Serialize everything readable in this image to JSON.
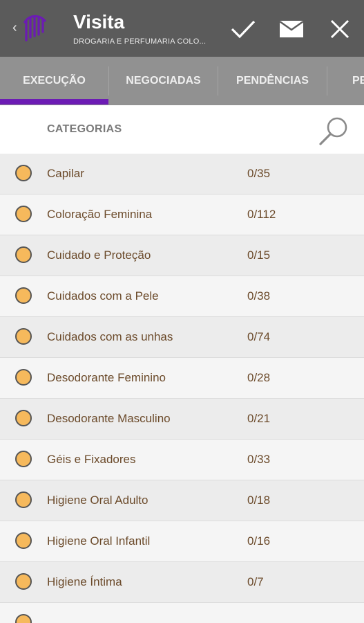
{
  "appbar": {
    "back_glyph": "‹",
    "title": "Visita",
    "subtitle": "DROGARIA E PERFUMARIA COLO...",
    "actions": [
      {
        "name": "confirm",
        "icon": "check-icon"
      },
      {
        "name": "email",
        "icon": "mail-icon"
      },
      {
        "name": "close",
        "icon": "close-icon"
      }
    ],
    "logo_color": "#6c1bb4"
  },
  "tabs": [
    {
      "label": "EXECUÇÃO",
      "selected": true
    },
    {
      "label": "NEGOCIADAS",
      "selected": false
    },
    {
      "label": "PENDÊNCIAS",
      "selected": false
    },
    {
      "label": "PE",
      "selected": false
    }
  ],
  "accent_color": "#6c1bb4",
  "list_header": {
    "label": "CATEGORIAS",
    "search_icon": "search-icon"
  },
  "status_color": "#f6b95c",
  "categories": [
    {
      "label": "Capilar",
      "count": "0/35"
    },
    {
      "label": "Coloração Feminina",
      "count": "0/112"
    },
    {
      "label": "Cuidado e Proteção",
      "count": "0/15"
    },
    {
      "label": "Cuidados com a Pele",
      "count": "0/38"
    },
    {
      "label": "Cuidados com as unhas",
      "count": "0/74"
    },
    {
      "label": "Desodorante Feminino",
      "count": "0/28"
    },
    {
      "label": "Desodorante Masculino",
      "count": "0/21"
    },
    {
      "label": "Géis e Fixadores",
      "count": "0/33"
    },
    {
      "label": "Higiene Oral Adulto",
      "count": "0/18"
    },
    {
      "label": "Higiene Oral Infantil",
      "count": "0/16"
    },
    {
      "label": "Higiene Íntima",
      "count": "0/7"
    },
    {
      "label": "",
      "count": ""
    }
  ]
}
